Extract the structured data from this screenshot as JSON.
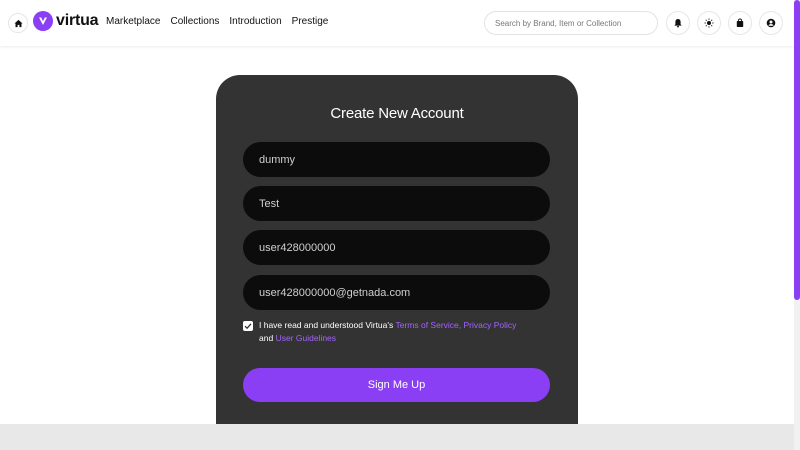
{
  "header": {
    "logo_text": "virtua",
    "nav": [
      "Marketplace",
      "Collections",
      "Introduction",
      "Prestige"
    ],
    "search_placeholder": "Search by Brand, Item or Collection",
    "icons": [
      "home-icon",
      "bell-icon",
      "sun-icon",
      "bag-icon",
      "user-icon"
    ]
  },
  "form": {
    "title": "Create New Account",
    "fields": {
      "first_name": "dummy",
      "last_name": "Test",
      "username": "user428000000",
      "email": "user428000000@getnada.com"
    },
    "terms": {
      "checked": true,
      "prefix": "I have read and understood Virtua's",
      "link_tos": "Terms of Service,",
      "link_privacy": "Privacy Policy",
      "conjunction": "and",
      "link_guidelines": "User Guidelines"
    },
    "submit_label": "Sign Me Up"
  },
  "colors": {
    "accent": "#8b3ff5",
    "card_bg": "#333333",
    "field_bg": "#0c0c0c",
    "link": "#a463ff"
  }
}
